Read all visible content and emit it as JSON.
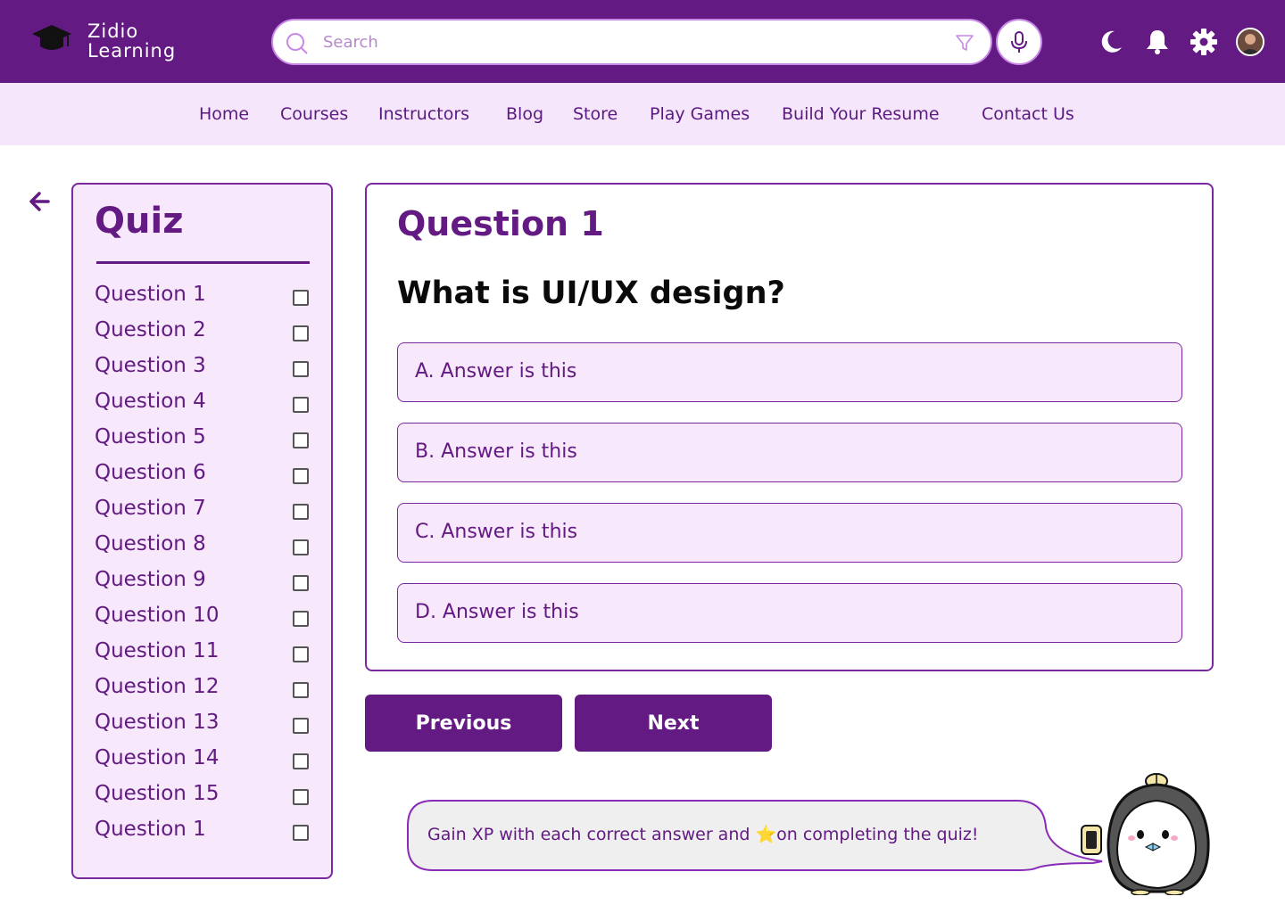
{
  "brand": {
    "line1": "Zidio",
    "line2": "Learning",
    "icon": "graduation-cap-icon"
  },
  "colors": {
    "primary": "#631a82",
    "light_bg": "#f5e6fb",
    "panel_bg": "#f7e8fc",
    "border_accent": "#c889e6",
    "star": "#f2c21b"
  },
  "search": {
    "placeholder": "Search",
    "value": "",
    "icons": [
      "search-icon",
      "filter-icon",
      "microphone-icon"
    ]
  },
  "header_icons": [
    "moon-icon",
    "bell-icon",
    "gear-icon",
    "avatar"
  ],
  "nav": {
    "items": [
      {
        "label": "Home"
      },
      {
        "label": "Courses"
      },
      {
        "label": "Instructors"
      },
      {
        "label": "Blog"
      },
      {
        "label": "Store"
      },
      {
        "label": "Play Games"
      },
      {
        "label": "Build Your Resume"
      },
      {
        "label": "Contact Us"
      }
    ]
  },
  "quiz": {
    "title": "Quiz",
    "questions": [
      {
        "label": "Question 1",
        "checked": false
      },
      {
        "label": "Question 2",
        "checked": false
      },
      {
        "label": "Question 3",
        "checked": false
      },
      {
        "label": "Question 4",
        "checked": false
      },
      {
        "label": "Question 5",
        "checked": false
      },
      {
        "label": "Question 6",
        "checked": false
      },
      {
        "label": "Question 7",
        "checked": false
      },
      {
        "label": "Question 8",
        "checked": false
      },
      {
        "label": "Question 9",
        "checked": false
      },
      {
        "label": "Question 10",
        "checked": false
      },
      {
        "label": "Question 11",
        "checked": false
      },
      {
        "label": "Question 12",
        "checked": false
      },
      {
        "label": "Question 13",
        "checked": false
      },
      {
        "label": "Question 14",
        "checked": false
      },
      {
        "label": "Question 15",
        "checked": false
      },
      {
        "label": "Question 1",
        "checked": false
      }
    ]
  },
  "current_question": {
    "heading": "Question 1",
    "text": "What is UI/UX design?",
    "options": [
      {
        "label": "A. Answer is this"
      },
      {
        "label": "B. Answer is this"
      },
      {
        "label": "C. Answer is this"
      },
      {
        "label": "D. Answer is this"
      }
    ]
  },
  "buttons": {
    "previous": "Previous",
    "next": "Next"
  },
  "tip": {
    "before_star": "Gain XP with each correct answer and ",
    "star": "⭐",
    "after_star": "on completing the quiz!",
    "mascot": "penguin-mascot"
  }
}
